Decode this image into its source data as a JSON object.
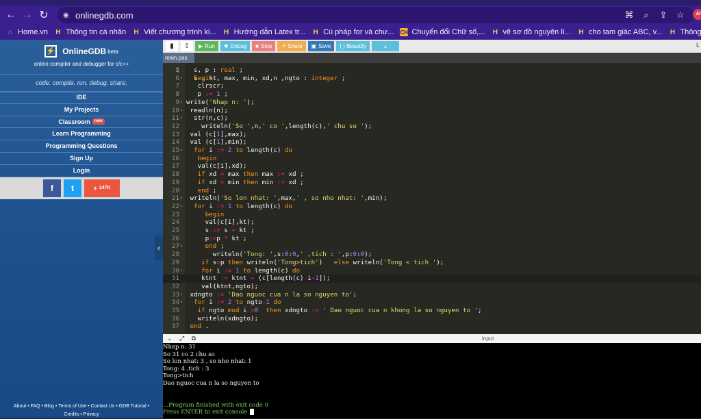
{
  "browser": {
    "url": "onlinegdb.com",
    "profile_initials": "AI",
    "bookmarks": [
      {
        "label": "Home.vn",
        "icon": "home-icon"
      },
      {
        "label": "Thông tin cá nhân",
        "icon": "h-icon"
      },
      {
        "label": "Viết chương trình ki...",
        "icon": "h-icon"
      },
      {
        "label": "Hướng dẫn Latex tr...",
        "icon": "h-icon"
      },
      {
        "label": "Cú pháp for và chư...",
        "icon": "h-icon"
      },
      {
        "label": "Chuyển đổi Chữ số,...",
        "icon": "convert-icon"
      },
      {
        "label": "vẽ sơ đồ nguyên lí...",
        "icon": "h-icon"
      },
      {
        "label": "cho tam giác ABC, v...",
        "icon": "h-icon"
      },
      {
        "label": "Thông tin cá nhân",
        "icon": "h-icon"
      }
    ]
  },
  "sidebar": {
    "brand": "OnlineGDB",
    "beta": "beta",
    "subtitle": "online compiler and debugger for c/c++",
    "tagline": "code. compile. run. debug. share.",
    "menu": [
      {
        "label": "IDE"
      },
      {
        "label": "My Projects"
      },
      {
        "label": "Classroom",
        "badge": "new"
      },
      {
        "label": "Learn Programming"
      },
      {
        "label": "Programming Questions"
      },
      {
        "label": "Sign Up"
      },
      {
        "label": "Login"
      }
    ],
    "share_count": "147K",
    "footer_line1": "About • FAQ • Blog • Terms of Use • Contact Us • GDB Tutorial •",
    "footer_line2": "Credits • Privacy"
  },
  "toolbar": {
    "run": "Run",
    "debug": "Debug",
    "stop": "Stop",
    "share": "Share",
    "save": "Save",
    "beautify": "{ } Beautify",
    "lang_partial": "L"
  },
  "editor": {
    "tab": "main.pas",
    "lines": [
      {
        "n": "5",
        "text": "  s, p : real ;"
      },
      {
        "n": "6",
        "text": "  begin",
        "fold": true
      },
      {
        "n": "7",
        "text": "   clrscr;"
      },
      {
        "n": "8",
        "text": "   p := 1 ;"
      },
      {
        "n": "9",
        "text": "write('Nhap n: ');",
        "fold": true
      },
      {
        "n": "10",
        "text": " readln(n);",
        "fold": true
      },
      {
        "n": "11",
        "text": "  str(n,c);",
        "fold": true
      },
      {
        "n": "12",
        "text": "    writeln('So ',n,' co ',length(c),' chu so ');"
      },
      {
        "n": "13",
        "text": " val (c[1],max);"
      },
      {
        "n": "14",
        "text": " val (c[1],min);"
      },
      {
        "n": "15",
        "text": "  for i := 2 to length(c) do",
        "fold": true
      },
      {
        "n": "16",
        "text": "   begin"
      },
      {
        "n": "17",
        "text": "   val(c[i],xd);"
      },
      {
        "n": "18",
        "text": "   if xd > max then max := xd ;"
      },
      {
        "n": "19",
        "text": "   if xd < min then min := xd ;"
      },
      {
        "n": "20",
        "text": "   end ;"
      },
      {
        "n": "21",
        "text": " writeln('So lon nhat: ',max,' , so nho nhat: ',min);",
        "fold": true
      },
      {
        "n": "22",
        "text": "  for i := 1 to length(c) do",
        "fold": true
      },
      {
        "n": "23",
        "text": "     begin"
      },
      {
        "n": "24",
        "text": "     val(c[i],kt);"
      },
      {
        "n": "25",
        "text": "     s := s + kt ;"
      },
      {
        "n": "26",
        "text": "     p:=p * kt ;"
      },
      {
        "n": "27",
        "text": "     end ;",
        "fold": true
      },
      {
        "n": "28",
        "text": "       writeln('Tong: ',s:0:0,' ,tich : ',p:0:0);"
      },
      {
        "n": "29",
        "text": "    if s>p then writeln('Tong>tich')   else writeln('Tong < tich ');"
      },
      {
        "n": "30",
        "text": "    for i := 1 to length(c) do",
        "fold": true
      },
      {
        "n": "31",
        "text": "    ktnt := ktnt + (c[length(c)-i+1]);",
        "active": true
      },
      {
        "n": "32",
        "text": "    val(ktnt,ngto);"
      },
      {
        "n": "33",
        "text": " xdngto := 'Dao nguoc cua n la so nguyen to';",
        "fold": true
      },
      {
        "n": "34",
        "text": "  for i := 2 to ngto-1 do",
        "fold": true
      },
      {
        "n": "35",
        "text": "   if ngto mod i =0  then xdngto := ' Dao nguoc cua n khong la so nguyen to ';"
      },
      {
        "n": "36",
        "text": "   writeln(xdngto);"
      },
      {
        "n": "37",
        "text": " end ."
      }
    ]
  },
  "io": {
    "label": "input",
    "output": [
      "Nhap n: 31",
      "So 31 co 2 chu so",
      "So lon nhat: 3 , so nho nhat: 1",
      "Tong: 4 ,tich : 3",
      "Tong>tich",
      "Dao nguoc cua n la so nguyen to",
      "",
      "",
      "...Program finished with exit code 0",
      "Press ENTER to exit console."
    ]
  },
  "colors": {
    "browser_chrome": "#3b1f8e",
    "sidebar": "#1c4f8c",
    "editor_bg": "#272822",
    "keyword": "#f92672",
    "string": "#e6db74",
    "number": "#ae81ff"
  }
}
